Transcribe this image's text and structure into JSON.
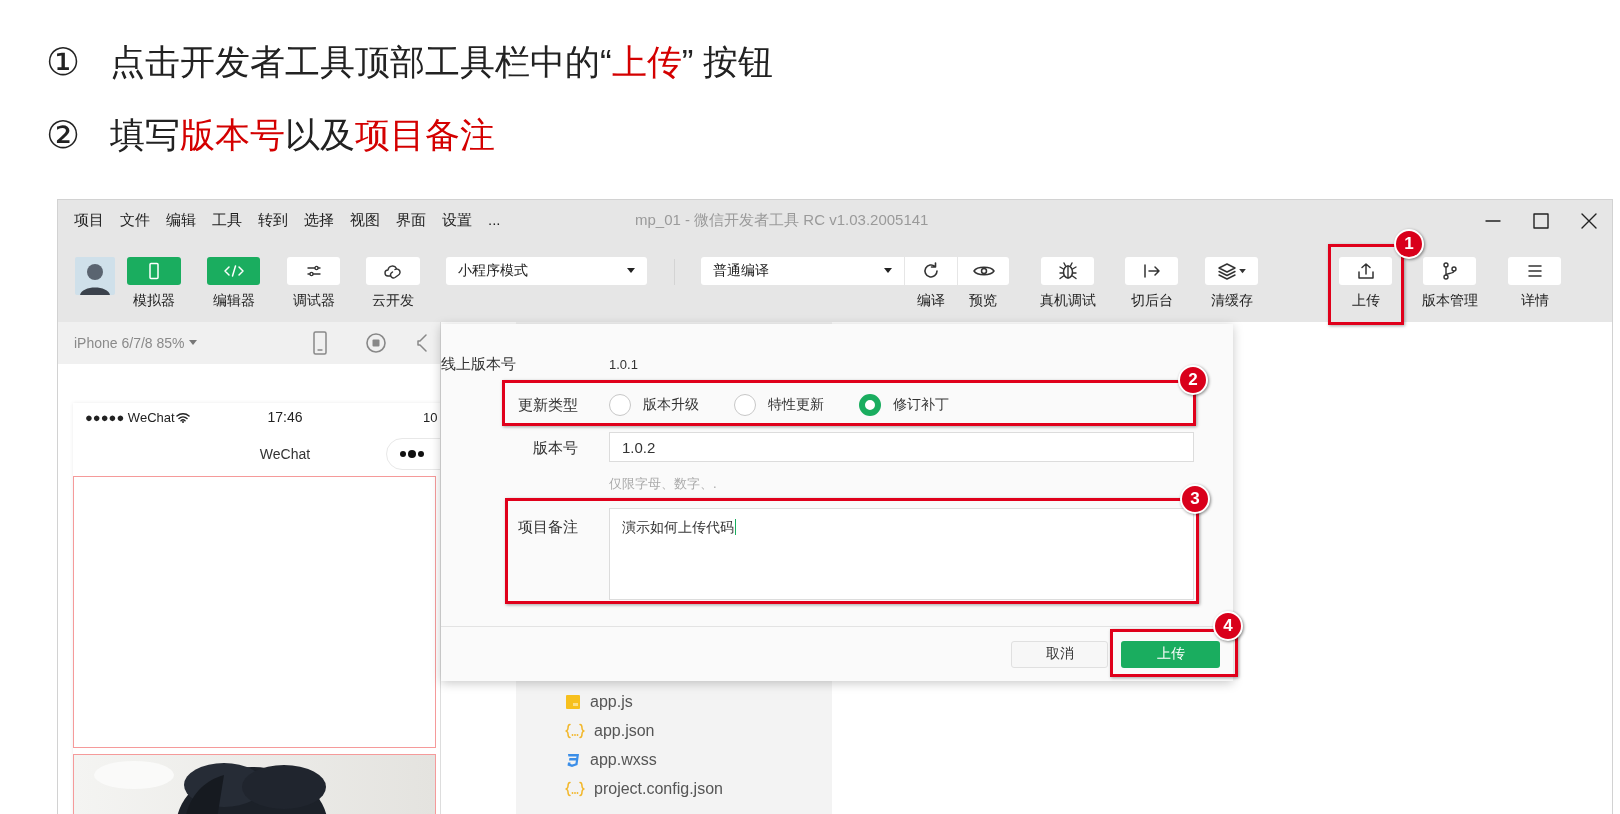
{
  "instructions": [
    {
      "number": "①",
      "segments": [
        {
          "text": "点击开发者工具顶部工具栏中的“",
          "highlight": false
        },
        {
          "text": "上传",
          "highlight": true
        },
        {
          "text": "” 按钮",
          "highlight": false
        }
      ]
    },
    {
      "number": "②",
      "segments": [
        {
          "text": "填写",
          "highlight": false
        },
        {
          "text": "版本号",
          "highlight": true
        },
        {
          "text": "以及",
          "highlight": false
        },
        {
          "text": "项目备注",
          "highlight": true
        }
      ]
    }
  ],
  "window": {
    "menu": [
      "项目",
      "文件",
      "编辑",
      "工具",
      "转到",
      "选择",
      "视图",
      "界面",
      "设置",
      "..."
    ],
    "title": "mp_01 - 微信开发者工具 RC v1.03.2005141"
  },
  "toolbar": {
    "view_buttons": [
      {
        "label": "模拟器",
        "selected": true
      },
      {
        "label": "编辑器",
        "selected": true
      },
      {
        "label": "调试器",
        "selected": false
      },
      {
        "label": "云开发",
        "selected": false
      }
    ],
    "mode_select": "小程序模式",
    "compile_select": "普通编译",
    "action_buttons": [
      "编译",
      "预览",
      "真机调试",
      "切后台",
      "清缓存",
      "上传",
      "版本管理",
      "详情"
    ]
  },
  "simulator": {
    "device": "iPhone 6/7/8 85%",
    "carrier": "●●●●● WeChat",
    "time": "17:46",
    "battery": "10",
    "nav_title": "WeChat"
  },
  "file_tree": [
    {
      "name": "app.js",
      "kind": "js"
    },
    {
      "name": "app.json",
      "kind": "json"
    },
    {
      "name": "app.wxss",
      "kind": "wxss"
    },
    {
      "name": "project.config.json",
      "kind": "json"
    }
  ],
  "dialog": {
    "online_version": {
      "label": "线上版本号",
      "value": "1.0.1"
    },
    "update_type": {
      "label": "更新类型",
      "options": [
        {
          "label": "版本升级",
          "selected": false
        },
        {
          "label": "特性更新",
          "selected": false
        },
        {
          "label": "修订补丁",
          "selected": true
        }
      ]
    },
    "version": {
      "label": "版本号",
      "value": "1.0.2",
      "hint": "仅限字母、数字、."
    },
    "note": {
      "label": "项目备注",
      "value": "演示如何上传代码"
    },
    "cancel_button": "取消",
    "upload_button": "上传"
  },
  "callouts": [
    "1",
    "2",
    "3",
    "4"
  ]
}
